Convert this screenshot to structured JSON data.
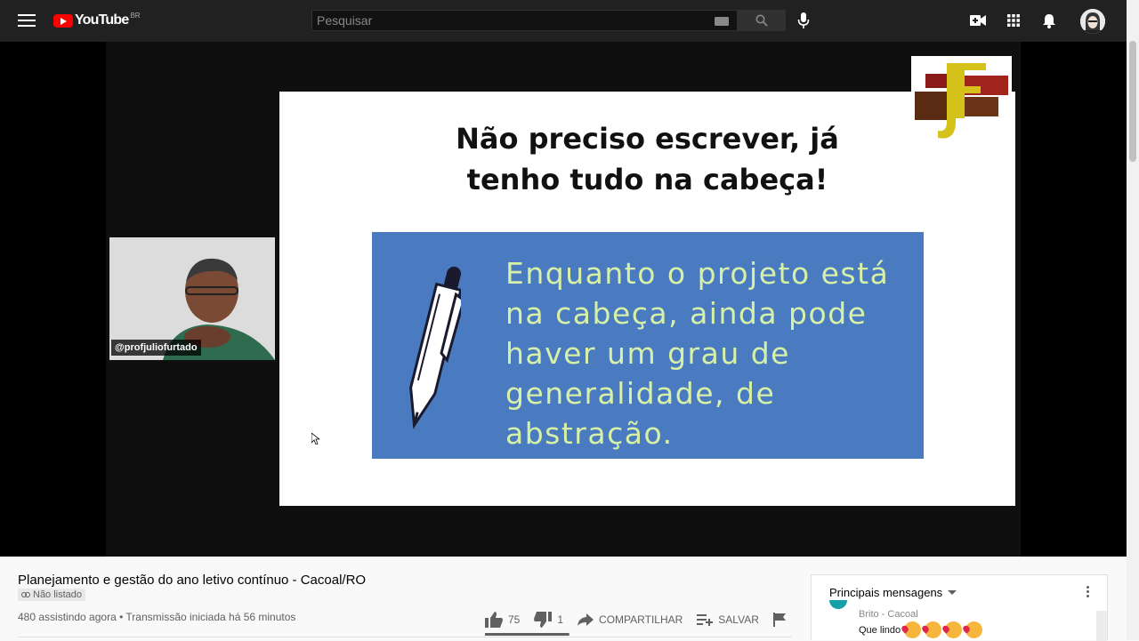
{
  "header": {
    "brand": "YouTube",
    "country": "BR",
    "search_placeholder": "Pesquisar"
  },
  "video": {
    "slide_title_line1": "Não preciso escrever, já",
    "slide_title_line2": "tenho tudo na cabeça!",
    "slide_body": "Enquanto o projeto está na cabeça, ainda pode haver um grau de generalidade, de abstração.",
    "camera_label": "@profjuliofurtado"
  },
  "info": {
    "title": "Planejamento e gestão do ano letivo contínuo - Cacoal/RO",
    "unlisted_badge": "Não listado",
    "viewers": "480 assistindo agora",
    "separator": "•",
    "stream_started": "Transmissão iniciada há 56 minutos",
    "likes": "75",
    "dislikes": "1",
    "share_label": "COMPARTILHAR",
    "save_label": "SALVAR",
    "like_ratio": 0.987
  },
  "chat": {
    "header": "Principais mensagens",
    "author": "Brito - Cacoal",
    "message": "Que lindo"
  },
  "colors": {
    "topbar": "#212121",
    "brand_red": "#ff0000",
    "slide_blue": "#4a7ac0",
    "slide_text_green": "#d7f0a8"
  }
}
